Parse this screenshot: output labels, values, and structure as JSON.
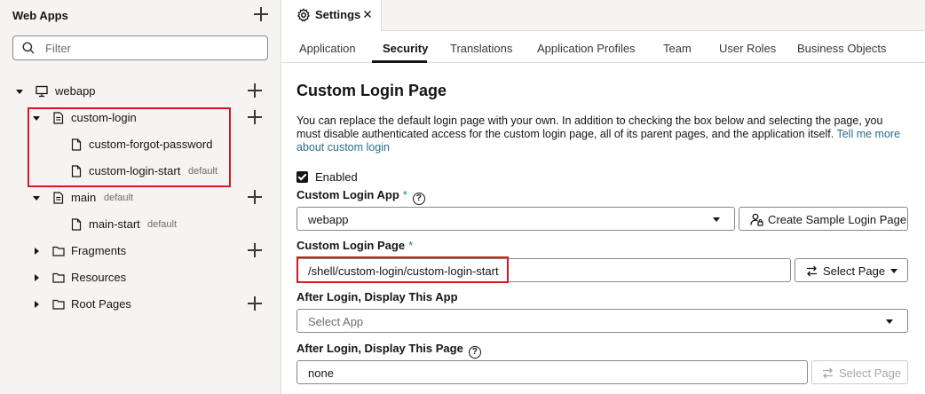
{
  "sidebar": {
    "title": "Web Apps",
    "filter_placeholder": "Filter",
    "tree": {
      "webapp": {
        "label": "webapp"
      },
      "custom_login": {
        "label": "custom-login"
      },
      "custom_forgot_password": {
        "label": "custom-forgot-password"
      },
      "custom_login_start": {
        "label": "custom-login-start",
        "tag": "default"
      },
      "main": {
        "label": "main",
        "tag": "default"
      },
      "main_start": {
        "label": "main-start",
        "tag": "default"
      },
      "fragments": {
        "label": "Fragments"
      },
      "resources": {
        "label": "Resources"
      },
      "root_pages": {
        "label": "Root Pages"
      }
    }
  },
  "doc_tab": {
    "label": "Settings"
  },
  "subtabs": {
    "application": "Application",
    "security": "Security",
    "translations": "Translations",
    "application_profiles": "Application Profiles",
    "team": "Team",
    "user_roles": "User Roles",
    "business_objects": "Business Objects",
    "active": "security"
  },
  "main": {
    "title": "Custom Login Page",
    "description": "You can replace the default login page with your own. In addition to checking the box below and selecting the page, you must disable authenticated access for the custom login page, all of its parent pages, and the application itself.",
    "description_link": "Tell me more about custom login",
    "enabled_label": "Enabled",
    "enabled_checked": true,
    "custom_login_app": {
      "label": "Custom Login App",
      "required_mark": "*",
      "help": "?",
      "value": "webapp",
      "button": "Create Sample Login Page"
    },
    "custom_login_page": {
      "label": "Custom Login Page",
      "required_mark": "*",
      "value": "/shell/custom-login/custom-login-start",
      "button": "Select Page"
    },
    "after_login_app": {
      "label": "After Login, Display This App",
      "placeholder": "Select App"
    },
    "after_login_page": {
      "label": "After Login, Display This Page",
      "help": "?",
      "value": "none",
      "button": "Select Page"
    }
  },
  "colors": {
    "highlight": "#d51920",
    "link": "#2a6f8a",
    "required": "#227ba0",
    "sidebar_bg": "#f5f4f2"
  }
}
